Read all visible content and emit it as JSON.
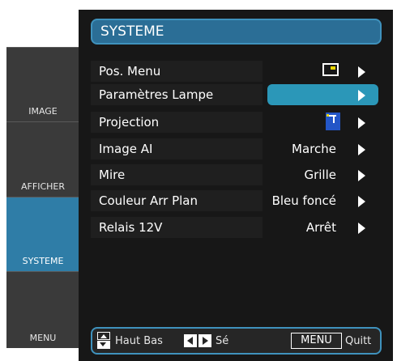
{
  "tabs": [
    {
      "label": "IMAGE",
      "active": false
    },
    {
      "label": "AFFICHER",
      "active": false
    },
    {
      "label": "SYSTEME",
      "active": true
    },
    {
      "label": "MENU",
      "active": false
    }
  ],
  "header": {
    "title": "SYSTEME"
  },
  "rows": [
    {
      "name": "Pos. Menu",
      "value": "",
      "icon": "menu-position-icon"
    },
    {
      "name": "Paramètres Lampe",
      "value": "",
      "selected": true
    },
    {
      "name": "Projection",
      "value": "",
      "icon": "projection-icon"
    },
    {
      "name": "Image AI",
      "value": "Marche"
    },
    {
      "name": "Mire",
      "value": "Grille"
    },
    {
      "name": "Couleur Arr Plan",
      "value": "Bleu foncé"
    },
    {
      "name": "Relais 12V",
      "value": "Arrêt"
    }
  ],
  "footer": {
    "updown_label": "Haut Bas",
    "leftright_label": "Sé",
    "menu_key": "MENU",
    "quit_label": "Quitt"
  },
  "colors": {
    "accent": "#2b6e96",
    "highlight": "#2b97b8",
    "panel": "#171717",
    "tab": "#3a3a3a"
  }
}
